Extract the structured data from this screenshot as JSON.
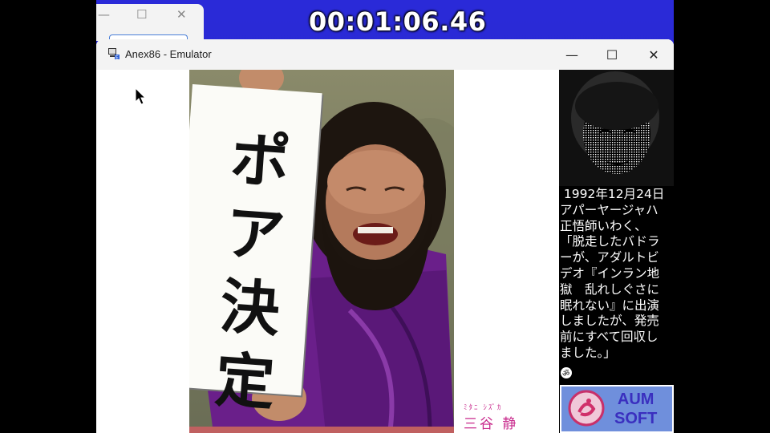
{
  "recording": {
    "timer": "00:01:06.46"
  },
  "background_window": {
    "minimize": "—",
    "maximize": "☐",
    "close": "✕"
  },
  "window": {
    "title": "Anex86 - Emulator",
    "minimize": "—",
    "maximize": "☐",
    "close": "✕"
  },
  "game": {
    "sign_text": "ポア決定",
    "credit": {
      "ruby": "ﾐﾀﾆ  ｼｽﾞｶ",
      "name": "三谷 静"
    },
    "side_text": " 1992年12月24日\nアパーヤージャハ\n正悟師いわく、\n「脱走したバドラ\nーが、アダルトビ\nデオ『インラン地\n獄　乱れしぐさに\n眠れない』に出演\nしましたが、発売\n前にすべて回収し\nました。」",
    "logo": {
      "line1": "AUM",
      "line2": "SOFT"
    }
  },
  "colors": {
    "desktop": "#2626c8",
    "credit": "#c82a8c",
    "robe": "#6a1f8a",
    "logo_bg": "#6f8fdc"
  }
}
